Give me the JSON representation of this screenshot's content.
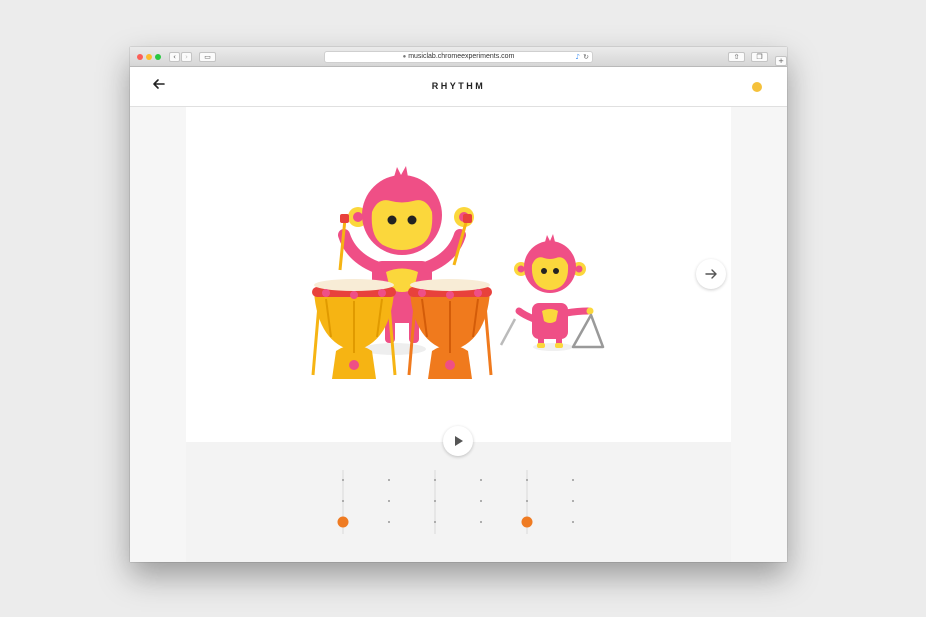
{
  "browser": {
    "url": "musiclab.chromeexperiments.com"
  },
  "header": {
    "title": "RHYTHM"
  },
  "colors": {
    "monkey_pink": "#ef4f86",
    "monkey_face": "#fbd73c",
    "drum_yellow": "#f6b413",
    "drum_orange": "#f07a1d",
    "note_orange": "#ef7b22",
    "help_yellow": "#f5c13b"
  },
  "icons": {
    "back": "arrow-left-icon",
    "next": "arrow-right-icon",
    "play": "play-icon",
    "help": "help-icon"
  },
  "sequencer": {
    "steps": 6,
    "rows": 3,
    "active_cells": [
      [
        0,
        2
      ],
      [
        4,
        2
      ]
    ]
  }
}
